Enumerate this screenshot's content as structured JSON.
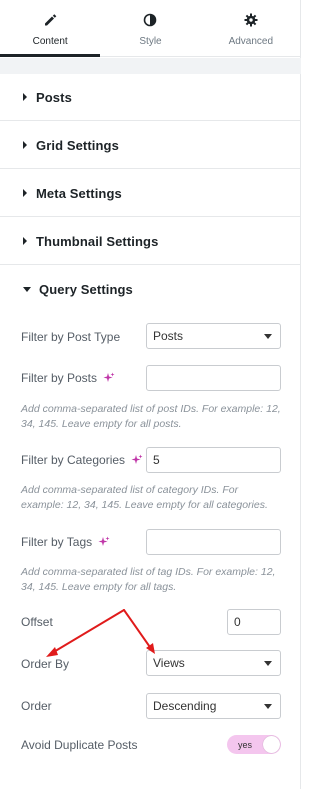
{
  "tabs": [
    {
      "label": "Content",
      "icon": "pencil-icon",
      "active": true
    },
    {
      "label": "Style",
      "icon": "half-circle-icon",
      "active": false
    },
    {
      "label": "Advanced",
      "icon": "gear-icon",
      "active": false
    }
  ],
  "sections": {
    "posts": "Posts",
    "grid": "Grid Settings",
    "meta": "Meta Settings",
    "thumbnail": "Thumbnail Settings",
    "query": "Query Settings"
  },
  "query": {
    "post_type": {
      "label": "Filter by Post Type",
      "value": "Posts"
    },
    "posts": {
      "label": "Filter by Posts",
      "value": "",
      "help": "Add comma-separated list of post IDs. For example: 12, 34, 145. Leave empty for all posts."
    },
    "categories": {
      "label": "Filter by Categories",
      "value": "5",
      "help": "Add comma-separated list of category IDs. For example: 12, 34, 145. Leave empty for all categories."
    },
    "tags": {
      "label": "Filter by Tags",
      "value": "",
      "help": "Add comma-separated list of tag IDs. For example: 12, 34, 145. Leave empty for all tags."
    },
    "offset": {
      "label": "Offset",
      "value": "0"
    },
    "order_by": {
      "label": "Order By",
      "value": "Views"
    },
    "order": {
      "label": "Order",
      "value": "Descending"
    },
    "avoid_duplicates": {
      "label": "Avoid Duplicate Posts",
      "state": "yes"
    }
  },
  "colors": {
    "accent": "#1d2327",
    "ai_icon": "#c036a8",
    "toggle_on": "#f4c6ee",
    "arrow": "#e01b1b"
  }
}
